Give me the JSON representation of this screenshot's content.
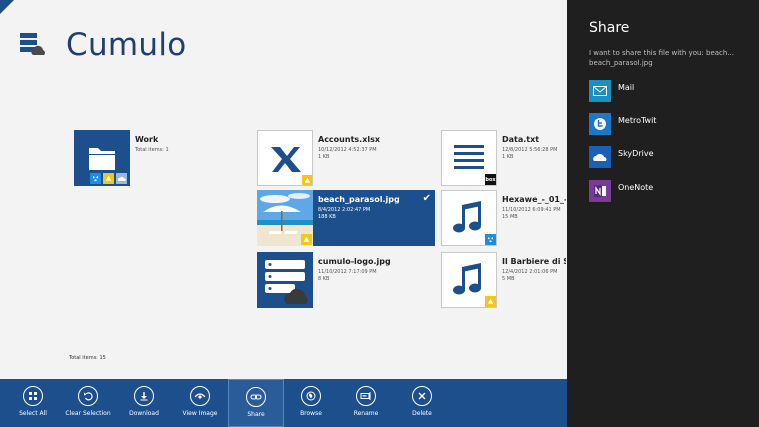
{
  "app": {
    "title": "Cumulo"
  },
  "folder": {
    "name": "Work",
    "meta": "Total items: 1"
  },
  "files": [
    {
      "name": "Accounts.xlsx",
      "date": "10/12/2012 4:52:37 PM",
      "size": "1 KB"
    },
    {
      "name": "beach_parasol.jpg",
      "date": "8/4/2012 2:02:47 PM",
      "size": "188 KB"
    },
    {
      "name": "cumulo-logo.jpg",
      "date": "11/10/2012 7:17:09 PM",
      "size": "8 KB"
    },
    {
      "name": "Data.txt",
      "date": "12/8/2012 5:56:28 PM",
      "size": "1 KB"
    },
    {
      "name": "Hexawe_-_01_-...",
      "date": "11/10/2012 6:09:41 PM",
      "size": "15 MB"
    },
    {
      "name": "Il Barbiere di Sivig",
      "date": "12/4/2012 2:01:06 PM",
      "size": "5 MB"
    }
  ],
  "badges": {
    "box": "box"
  },
  "footer": {
    "total": "Total items: 15"
  },
  "appbar": {
    "buttons": [
      {
        "label": "Select All",
        "icon": "grid-icon"
      },
      {
        "label": "Clear Selection",
        "icon": "undo-icon"
      },
      {
        "label": "Download",
        "icon": "download-icon"
      },
      {
        "label": "View Image",
        "icon": "eye-icon"
      },
      {
        "label": "Share",
        "icon": "link-icon"
      },
      {
        "label": "Browse",
        "icon": "globe-icon"
      },
      {
        "label": "Rename",
        "icon": "rename-icon"
      },
      {
        "label": "Delete",
        "icon": "close-icon"
      }
    ]
  },
  "share": {
    "title": "Share",
    "description": "I want to share this file with you: beach... beach_parasol.jpg",
    "targets": [
      {
        "name": "Mail",
        "color": "#1b8fbf"
      },
      {
        "name": "MetroTwit",
        "color": "#1d78c8"
      },
      {
        "name": "SkyDrive",
        "color": "#1c5fb8"
      },
      {
        "name": "OneNote",
        "color": "#7a3b96"
      }
    ]
  },
  "colors": {
    "accent": "#1d4f8d",
    "pane": "#1f1f1f",
    "background": "#f3f3f3"
  }
}
